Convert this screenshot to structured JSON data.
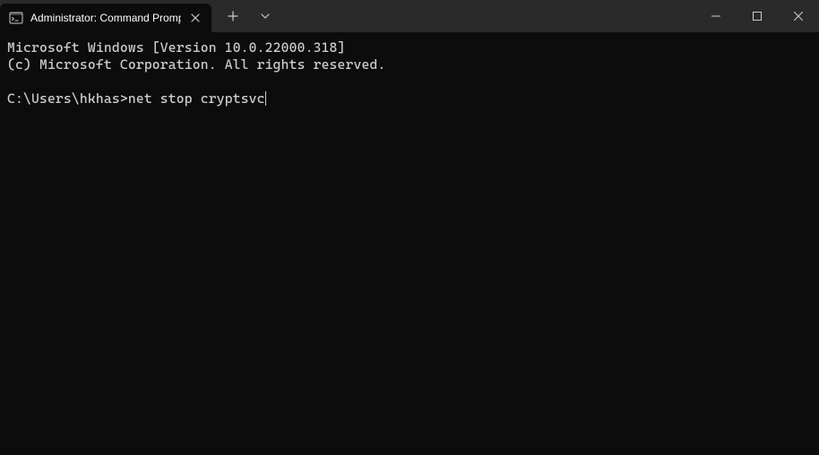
{
  "titlebar": {
    "tab": {
      "title": "Administrator: Command Promp",
      "icon": "terminal-icon"
    },
    "newTab": "+",
    "dropdown": "v"
  },
  "terminal": {
    "line1": "Microsoft Windows [Version 10.0.22000.318]",
    "line2": "(c) Microsoft Corporation. All rights reserved.",
    "blank": "",
    "prompt": "C:\\Users\\hkhas>",
    "command": "net stop cryptsvc"
  }
}
